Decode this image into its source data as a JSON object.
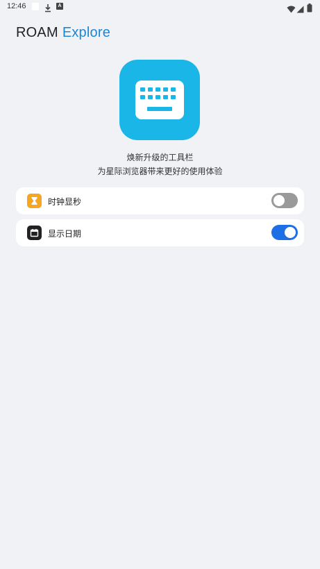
{
  "status_bar": {
    "time": "12:46",
    "notification_letter": "A"
  },
  "app": {
    "title_part1": "ROAM",
    "title_part2": "Explore"
  },
  "hero": {
    "icon": "keyboard-icon",
    "line1": "焕新升级的工具栏",
    "line2": "为星际浏览器带来更好的使用体验"
  },
  "settings": [
    {
      "label": "时钟显秒",
      "icon": "hourglass-icon",
      "icon_color": "#F5A623",
      "enabled": false
    },
    {
      "label": "显示日期",
      "icon": "calendar-icon",
      "icon_color": "#222222",
      "enabled": true
    }
  ],
  "colors": {
    "background": "#F1F2F6",
    "accent": "#1A86D8",
    "hero_icon_bg": "#1BB6E8",
    "toggle_on": "#1E6FE6",
    "toggle_off": "#9A9A9A"
  }
}
